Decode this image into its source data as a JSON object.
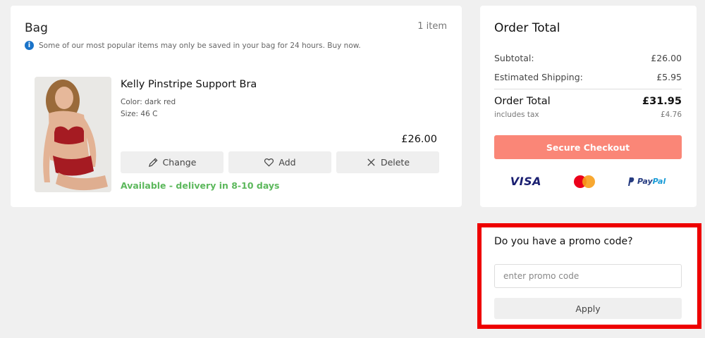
{
  "bag": {
    "title": "Bag",
    "count": "1 item",
    "notice": "Some of our most popular items may only be saved in your bag for 24 hours. Buy now.",
    "item": {
      "name": "Kelly Pinstripe Support Bra",
      "color": "Color: dark red",
      "size": "Size: 46 C",
      "price": "£26.00",
      "actions": {
        "change": "Change",
        "add": "Add",
        "delete": "Delete"
      },
      "availability": "Available - delivery in 8-10 days"
    }
  },
  "order": {
    "title": "Order Total",
    "subtotal_label": "Subtotal:",
    "subtotal_value": "£26.00",
    "shipping_label": "Estimated Shipping:",
    "shipping_value": "£5.95",
    "total_label": "Order Total",
    "total_value": "£31.95",
    "tax_label": "includes tax",
    "tax_value": "£4.76",
    "checkout_label": "Secure Checkout",
    "payments": {
      "visa": "VISA",
      "paypal_1": "Pay",
      "paypal_2": "Pal"
    }
  },
  "promo": {
    "title": "Do you have a promo code?",
    "placeholder": "enter promo code",
    "apply_label": "Apply"
  },
  "colors": {
    "checkout": "#fa8677",
    "available": "#5cb85c",
    "highlight": "#ee0000",
    "info": "#1a73c9"
  }
}
